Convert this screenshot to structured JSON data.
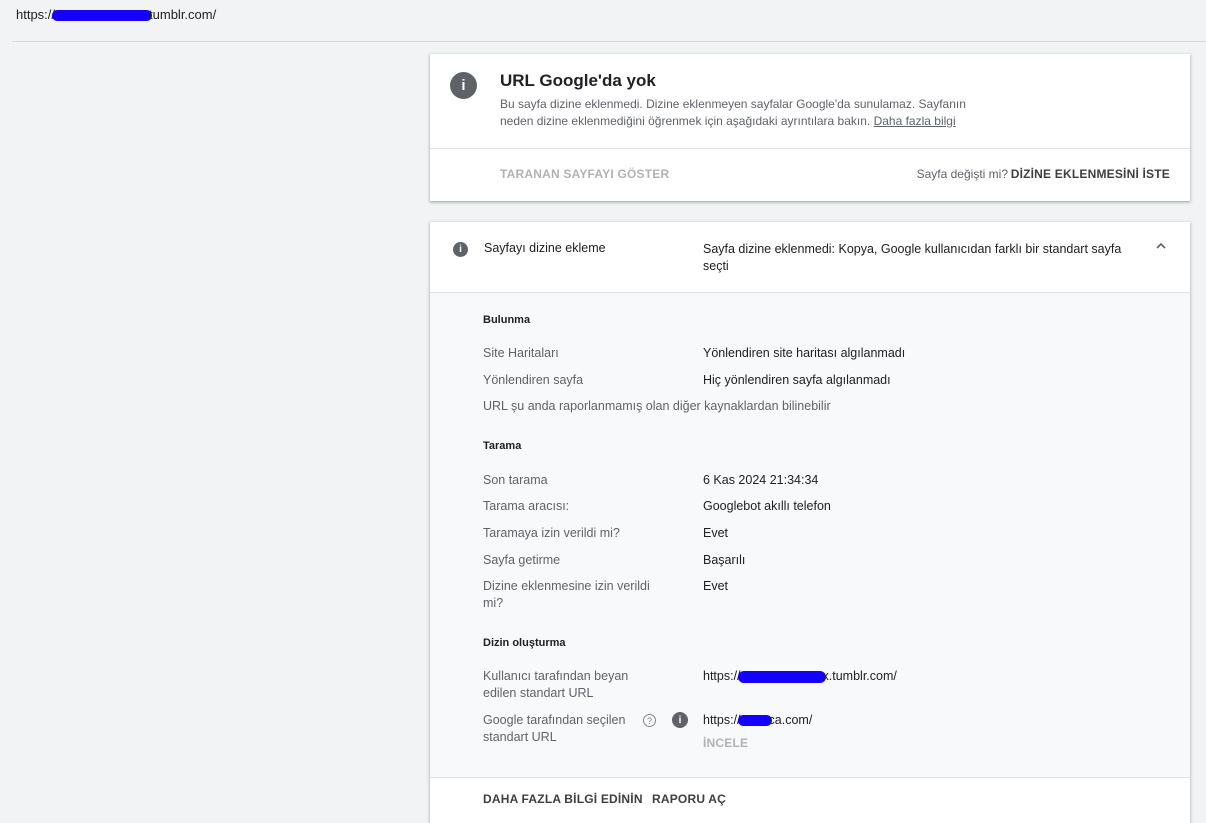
{
  "address_bar": {
    "url_prefix": "https://",
    "url_suffix": "tumblr.com/"
  },
  "card_summary": {
    "title": "URL Google'da yok",
    "description": "Bu sayfa dizine eklenmedi. Dizine eklenmeyen sayfalar Google'da sunulamaz. Sayfanın neden dizine eklenmediğini öğrenmek için aşağıdaki ayrıntılara bakın.",
    "learn_more_link": "Daha fazla bilgi",
    "view_crawled_button": "TARANAN SAYFAYI GÖSTER",
    "page_changed_question": "Sayfa değişti mi?",
    "request_indexing_button": "DİZİNE EKLENMESİNİ İSTE"
  },
  "card_indexing": {
    "label": "Sayfayı dizine ekleme",
    "status": "Sayfa dizine eklenmedi: Kopya, Google kullanıcıdan farklı bir standart sayfa seçti",
    "sections": {
      "discovery": {
        "title": "Bulunma",
        "sitemaps_label": "Site Haritaları",
        "sitemaps_value": "Yönlendiren site haritası algılanmadı",
        "referring_label": "Yönlendiren sayfa",
        "referring_value": "Hiç yönlendiren sayfa algılanmadı",
        "note": "URL şu anda raporlanmamış olan diğer kaynaklardan bilinebilir"
      },
      "crawl": {
        "title": "Tarama",
        "last_crawl_label": "Son tarama",
        "last_crawl_value": "6 Kas 2024 21:34:34",
        "crawler_label": "Tarama aracısı:",
        "crawler_value": "Googlebot akıllı telefon",
        "crawl_allowed_label": "Taramaya izin verildi mi?",
        "crawl_allowed_value": "Evet",
        "fetch_label": "Sayfa getirme",
        "fetch_value": "Başarılı",
        "index_allowed_label": "Dizine eklenmesine izin verildi mi?",
        "index_allowed_value": "Evet"
      },
      "indexing": {
        "title": "Dizin oluşturma",
        "user_canonical_label": "Kullanıcı tarafından beyan edilen standart URL",
        "user_canonical_prefix": "https://",
        "user_canonical_suffix": "x.tumblr.com/",
        "google_canonical_label": "Google tarafından seçilen standart URL",
        "google_canonical_prefix": "https://",
        "google_canonical_suffix": "ca.com/",
        "inspect_button": "İNCELE"
      }
    },
    "learn_more_button": "DAHA FAZLA BİLGİ EDİNİN",
    "open_report_button": "RAPORU AÇ"
  }
}
